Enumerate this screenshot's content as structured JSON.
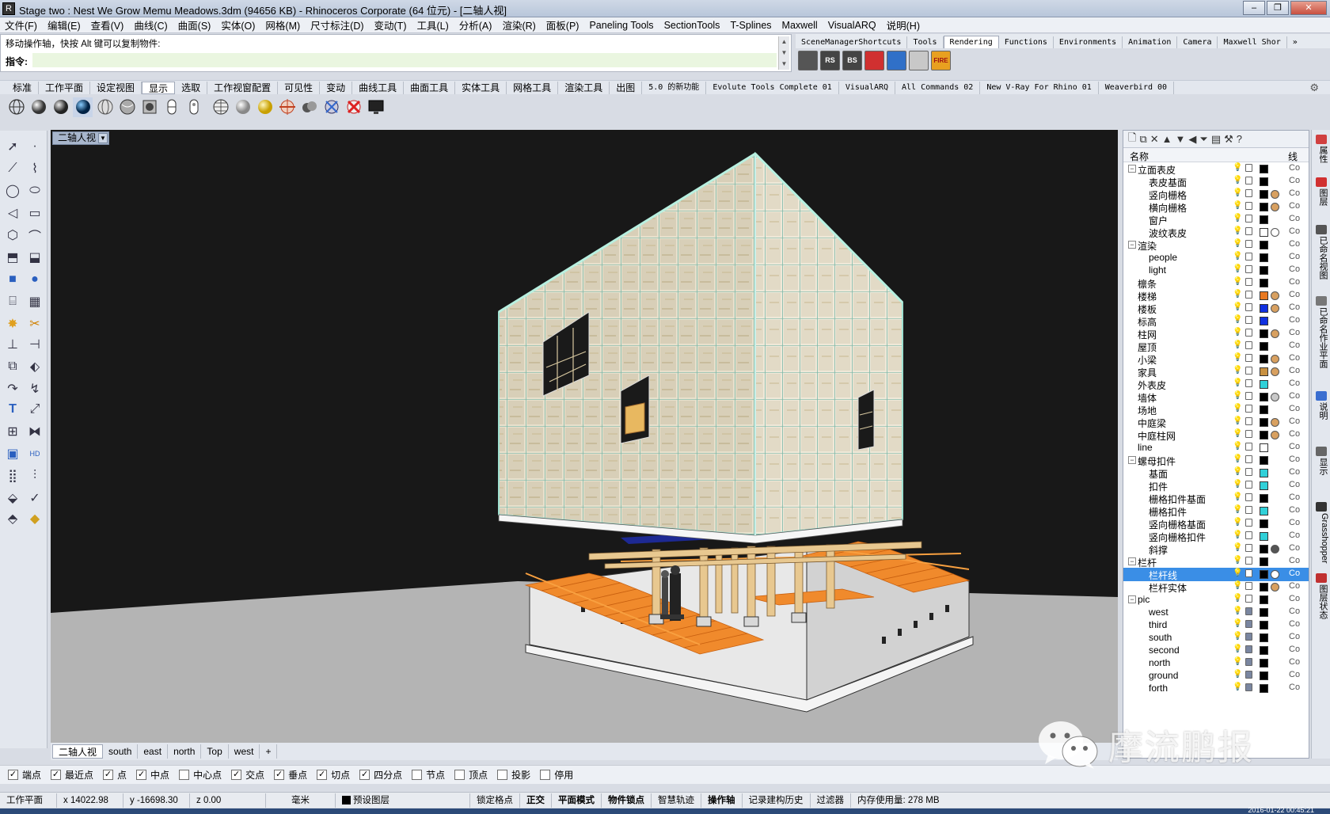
{
  "window": {
    "title": "Stage two : Nest We Grow Memu Meadows.3dm (94656 KB) - Rhinoceros Corporate (64 位元) - [二轴人视]"
  },
  "menu": [
    "文件(F)",
    "编辑(E)",
    "查看(V)",
    "曲线(C)",
    "曲面(S)",
    "实体(O)",
    "网格(M)",
    "尺寸标注(D)",
    "变动(T)",
    "工具(L)",
    "分析(A)",
    "渲染(R)",
    "面板(P)",
    "Paneling Tools",
    "SectionTools",
    "T-Splines",
    "Maxwell",
    "VisualARQ",
    "说明(H)"
  ],
  "command": {
    "message": "移动操作轴，快按 Alt 键可以复制物件:",
    "prompt_label": "指令:"
  },
  "top_tabs": [
    "SceneManagerShortcuts",
    "Tools",
    "Rendering",
    "Functions",
    "Environments",
    "Animation",
    "Camera",
    "Maxwell Shor"
  ],
  "top_tabs_active": "Rendering",
  "render_icons": [
    {
      "name": "render-icon-1",
      "label": "",
      "color": "#555555"
    },
    {
      "name": "render-icon-rs",
      "label": "RS",
      "color": "#444444"
    },
    {
      "name": "render-icon-bs",
      "label": "BS",
      "color": "#444444"
    },
    {
      "name": "render-icon-red",
      "label": "",
      "color": "#d03030"
    },
    {
      "name": "render-icon-blue",
      "label": "",
      "color": "#3070c8"
    },
    {
      "name": "render-icon-disc",
      "label": "",
      "color": "#c8c8c8"
    },
    {
      "name": "render-icon-fire",
      "label": "FIRE",
      "color": "#e8a020"
    }
  ],
  "main_tabs": [
    "标准",
    "工作平面",
    "设定视图",
    "显示",
    "选取",
    "工作视窗配置",
    "可见性",
    "变动",
    "曲线工具",
    "曲面工具",
    "实体工具",
    "网格工具",
    "渲染工具",
    "出图",
    "5.0 的新功能",
    "Evolute Tools Complete 01",
    "VisualARQ",
    "All Commands 02",
    "New V-Ray For Rhino 01",
    "Weaverbird 00"
  ],
  "main_tabs_active": "显示",
  "viewport": {
    "title": "二轴人视"
  },
  "viewport_tabs": [
    "二轴人视",
    "south",
    "east",
    "north",
    "Top",
    "west"
  ],
  "viewport_tabs_add": "+",
  "layers": {
    "header_name": "名称",
    "header_line": "线",
    "rows": [
      {
        "name": "立面表皮",
        "indent": 0,
        "expander": "−",
        "color": "#000000",
        "mat": "",
        "lock": "open",
        "bulb": "#e8d040"
      },
      {
        "name": "表皮基面",
        "indent": 1,
        "expander": "",
        "color": "#000000",
        "mat": "",
        "lock": "open",
        "bulb": "#3a8ee6"
      },
      {
        "name": "竖向栅格",
        "indent": 1,
        "expander": "",
        "color": "#000000",
        "mat": "#d8a060",
        "lock": "open",
        "bulb": "#e8d040"
      },
      {
        "name": "横向栅格",
        "indent": 1,
        "expander": "",
        "color": "#000000",
        "mat": "#d8a060",
        "lock": "open",
        "bulb": "#e8d040"
      },
      {
        "name": "窗户",
        "indent": 1,
        "expander": "",
        "color": "#000000",
        "mat": "",
        "lock": "open",
        "bulb": "#e8d040"
      },
      {
        "name": "波纹表皮",
        "indent": 1,
        "expander": "",
        "color": "#ffffff",
        "mat": "#ffffff",
        "lock": "open",
        "bulb": "#e8d040"
      },
      {
        "name": "渲染",
        "indent": 0,
        "expander": "−",
        "color": "#000000",
        "mat": "",
        "lock": "open",
        "bulb": "#e8d040"
      },
      {
        "name": "people",
        "indent": 1,
        "expander": "",
        "color": "#000000",
        "mat": "",
        "lock": "open",
        "bulb": "#e8d040"
      },
      {
        "name": "light",
        "indent": 1,
        "expander": "",
        "color": "#000000",
        "mat": "",
        "lock": "open",
        "bulb": "#e8d040"
      },
      {
        "name": "檩条",
        "indent": 0,
        "expander": "",
        "color": "#000000",
        "mat": "",
        "lock": "open",
        "bulb": "#e8d040"
      },
      {
        "name": "楼梯",
        "indent": 0,
        "expander": "",
        "color": "#e87820",
        "mat": "#d8a060",
        "lock": "open",
        "bulb": "#e8d040"
      },
      {
        "name": "楼板",
        "indent": 0,
        "expander": "",
        "color": "#1030e0",
        "mat": "#d8a060",
        "lock": "open",
        "bulb": "#e8d040"
      },
      {
        "name": "标高",
        "indent": 0,
        "expander": "",
        "color": "#1030e0",
        "mat": "",
        "lock": "open",
        "bulb": "#3a8ee6"
      },
      {
        "name": "柱网",
        "indent": 0,
        "expander": "",
        "color": "#000000",
        "mat": "#d8a060",
        "lock": "open",
        "bulb": "#e8d040"
      },
      {
        "name": "屋顶",
        "indent": 0,
        "expander": "",
        "color": "#000000",
        "mat": "",
        "lock": "open",
        "bulb": "#e8d040"
      },
      {
        "name": "小梁",
        "indent": 0,
        "expander": "",
        "color": "#000000",
        "mat": "#d8a060",
        "lock": "open",
        "bulb": "#e8d040"
      },
      {
        "name": "家具",
        "indent": 0,
        "expander": "",
        "color": "#c89040",
        "mat": "#d8a060",
        "lock": "open",
        "bulb": "#e8d040"
      },
      {
        "name": "外表皮",
        "indent": 0,
        "expander": "",
        "color": "#30d0d8",
        "mat": "",
        "lock": "open",
        "bulb": "#e8d040"
      },
      {
        "name": "墙体",
        "indent": 0,
        "expander": "",
        "color": "#000000",
        "mat": "#c8c8c8",
        "lock": "open",
        "bulb": "#e8d040"
      },
      {
        "name": "场地",
        "indent": 0,
        "expander": "",
        "color": "#000000",
        "mat": "",
        "lock": "open",
        "bulb": "#e8d040"
      },
      {
        "name": "中庭梁",
        "indent": 0,
        "expander": "",
        "color": "#000000",
        "mat": "#d8a060",
        "lock": "open",
        "bulb": "#e8d040"
      },
      {
        "name": "中庭柱网",
        "indent": 0,
        "expander": "",
        "color": "#000000",
        "mat": "#d8a060",
        "lock": "open",
        "bulb": "#e8d040"
      },
      {
        "name": "line",
        "indent": 0,
        "expander": "",
        "color": "#ffffff",
        "mat": "",
        "lock": "open",
        "bulb": "#3a8ee6"
      },
      {
        "name": "螺母扣件",
        "indent": 0,
        "expander": "−",
        "color": "#000000",
        "mat": "",
        "lock": "open",
        "bulb": "#e8d040"
      },
      {
        "name": "基面",
        "indent": 1,
        "expander": "",
        "color": "#30d0d8",
        "mat": "",
        "lock": "open",
        "bulb": "#3a8ee6"
      },
      {
        "name": "扣件",
        "indent": 1,
        "expander": "",
        "color": "#30d0d8",
        "mat": "",
        "lock": "open",
        "bulb": "#e8d040"
      },
      {
        "name": "栅格扣件基面",
        "indent": 1,
        "expander": "",
        "color": "#000000",
        "mat": "",
        "lock": "open",
        "bulb": "#3a8ee6"
      },
      {
        "name": "栅格扣件",
        "indent": 1,
        "expander": "",
        "color": "#30d0d8",
        "mat": "",
        "lock": "open",
        "bulb": "#e8d040"
      },
      {
        "name": "竖向栅格基面",
        "indent": 1,
        "expander": "",
        "color": "#000000",
        "mat": "",
        "lock": "open",
        "bulb": "#3a8ee6"
      },
      {
        "name": "竖向栅格扣件",
        "indent": 1,
        "expander": "",
        "color": "#30d0d8",
        "mat": "",
        "lock": "open",
        "bulb": "#e8d040"
      },
      {
        "name": "斜撑",
        "indent": 1,
        "expander": "",
        "color": "#000000",
        "mat": "#555555",
        "lock": "open",
        "bulb": "#e8d040"
      },
      {
        "name": "栏杆",
        "indent": 0,
        "expander": "−",
        "color": "#000000",
        "mat": "",
        "lock": "open",
        "bulb": "#e8d040"
      },
      {
        "name": "栏杆线",
        "indent": 1,
        "expander": "",
        "color": "#000000",
        "mat": "#ffffff",
        "lock": "open",
        "bulb": "#e8d040",
        "selected": true
      },
      {
        "name": "栏杆实体",
        "indent": 1,
        "expander": "",
        "color": "#000000",
        "mat": "#d8a060",
        "lock": "open",
        "bulb": "#e8d040"
      },
      {
        "name": "pic",
        "indent": 0,
        "expander": "−",
        "color": "#000000",
        "mat": "",
        "lock": "open",
        "bulb": "#3a8ee6"
      },
      {
        "name": "west",
        "indent": 1,
        "expander": "",
        "color": "#000000",
        "mat": "",
        "lock": "closed",
        "bulb": "#3a8ee6"
      },
      {
        "name": "third",
        "indent": 1,
        "expander": "",
        "color": "#000000",
        "mat": "",
        "lock": "closed",
        "bulb": "#3a8ee6"
      },
      {
        "name": "south",
        "indent": 1,
        "expander": "",
        "color": "#000000",
        "mat": "",
        "lock": "closed",
        "bulb": "#3a8ee6"
      },
      {
        "name": "second",
        "indent": 1,
        "expander": "",
        "color": "#000000",
        "mat": "",
        "lock": "closed",
        "bulb": "#3a8ee6"
      },
      {
        "name": "north",
        "indent": 1,
        "expander": "",
        "color": "#000000",
        "mat": "",
        "lock": "closed",
        "bulb": "#3a8ee6"
      },
      {
        "name": "ground",
        "indent": 1,
        "expander": "",
        "color": "#000000",
        "mat": "",
        "lock": "closed",
        "bulb": "#3a8ee6"
      },
      {
        "name": "forth",
        "indent": 1,
        "expander": "",
        "color": "#000000",
        "mat": "",
        "lock": "closed",
        "bulb": "#3a8ee6"
      }
    ],
    "co_label": "Co"
  },
  "right_vertical_tabs": [
    "属性",
    "图层",
    "已命名视图",
    "已命名作业平面",
    "说明",
    "显示",
    "Grasshopper",
    "图层状态"
  ],
  "osnap": [
    {
      "label": "端点",
      "checked": true
    },
    {
      "label": "最近点",
      "checked": true
    },
    {
      "label": "点",
      "checked": true
    },
    {
      "label": "中点",
      "checked": true
    },
    {
      "label": "中心点",
      "checked": false
    },
    {
      "label": "交点",
      "checked": true
    },
    {
      "label": "垂点",
      "checked": true
    },
    {
      "label": "切点",
      "checked": true
    },
    {
      "label": "四分点",
      "checked": true
    },
    {
      "label": "节点",
      "checked": false
    },
    {
      "label": "顶点",
      "checked": false
    },
    {
      "label": "投影",
      "checked": false
    },
    {
      "label": "停用",
      "checked": false
    }
  ],
  "status": {
    "cplane": "工作平面",
    "x": "x 14022.98",
    "y": "y -16698.30",
    "z": "z 0.00",
    "units": "毫米",
    "layer": "预设图层",
    "grid_snap": "锁定格点",
    "ortho": "正交",
    "planar": "平面模式",
    "osnap": "物件锁点",
    "smarttrack": "智慧轨迹",
    "gumball": "操作轴",
    "history": "记录建构历史",
    "filter": "过滤器",
    "memory": "内存使用量: 278 MB"
  },
  "watermark": {
    "text": "摩流鹏报"
  },
  "taskbar": {
    "clock": "2016-01-22 00:45:21"
  },
  "colors": {
    "viewport_bg": "#181818",
    "ground": "#b8b8b8",
    "orange": "#f08a2c",
    "glass_frame": "#9fe0d0",
    "selected_row": "#3a8ee6"
  }
}
